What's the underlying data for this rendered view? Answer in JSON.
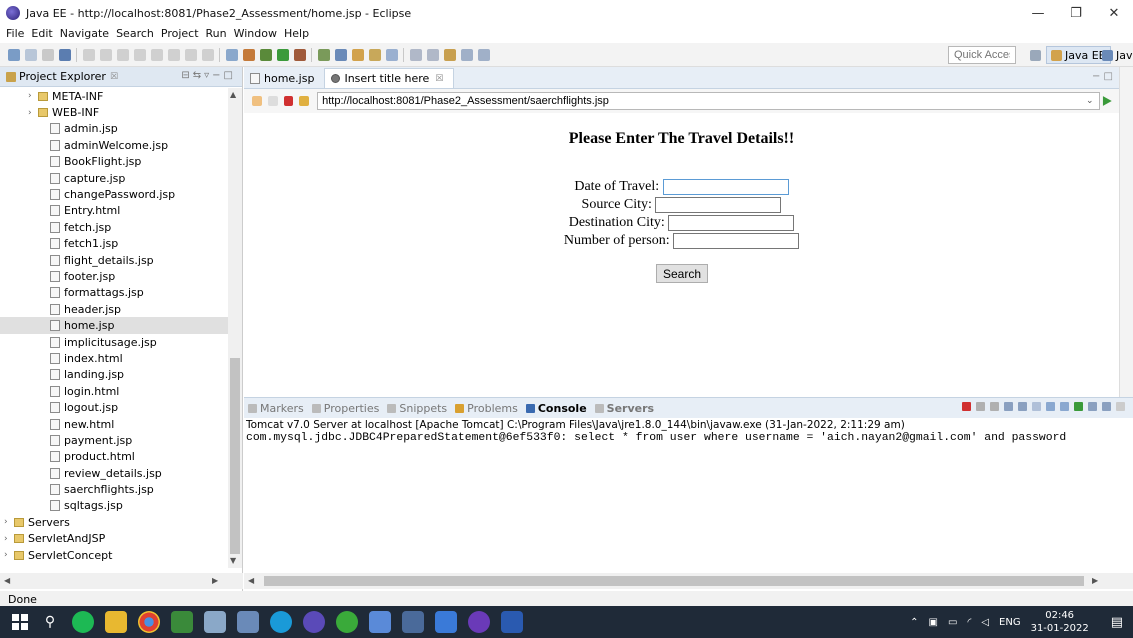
{
  "window": {
    "title": "Java EE - http://localhost:8081/Phase2_Assessment/home.jsp - Eclipse",
    "minimize": "—",
    "maximize": "❐",
    "close": "✕"
  },
  "menu": [
    "File",
    "Edit",
    "Navigate",
    "Search",
    "Project",
    "Run",
    "Window",
    "Help"
  ],
  "toolbar": {
    "quick_access_placeholder": "Quick Access",
    "perspective_active": "Java EE",
    "perspective_other": "Java"
  },
  "explorer": {
    "tab_label": "Project Explorer",
    "tab_close": "☒",
    "items": [
      {
        "label": "META-INF",
        "type": "folder",
        "indent": 2,
        "twisty": "›"
      },
      {
        "label": "WEB-INF",
        "type": "folder",
        "indent": 2,
        "twisty": "›"
      },
      {
        "label": "admin.jsp",
        "type": "file",
        "indent": 3
      },
      {
        "label": "adminWelcome.jsp",
        "type": "file",
        "indent": 3
      },
      {
        "label": "BookFlight.jsp",
        "type": "file",
        "indent": 3
      },
      {
        "label": "capture.jsp",
        "type": "file",
        "indent": 3
      },
      {
        "label": "changePassword.jsp",
        "type": "file",
        "indent": 3
      },
      {
        "label": "Entry.html",
        "type": "file",
        "indent": 3
      },
      {
        "label": "fetch.jsp",
        "type": "file",
        "indent": 3
      },
      {
        "label": "fetch1.jsp",
        "type": "file",
        "indent": 3
      },
      {
        "label": "flight_details.jsp",
        "type": "file",
        "indent": 3
      },
      {
        "label": "footer.jsp",
        "type": "file",
        "indent": 3
      },
      {
        "label": "formattags.jsp",
        "type": "file",
        "indent": 3
      },
      {
        "label": "header.jsp",
        "type": "file",
        "indent": 3
      },
      {
        "label": "home.jsp",
        "type": "file",
        "indent": 3,
        "selected": true
      },
      {
        "label": "implicitusage.jsp",
        "type": "file",
        "indent": 3
      },
      {
        "label": "index.html",
        "type": "file",
        "indent": 3
      },
      {
        "label": "landing.jsp",
        "type": "file",
        "indent": 3
      },
      {
        "label": "login.html",
        "type": "file",
        "indent": 3
      },
      {
        "label": "logout.jsp",
        "type": "file",
        "indent": 3
      },
      {
        "label": "new.html",
        "type": "file",
        "indent": 3
      },
      {
        "label": "payment.jsp",
        "type": "file",
        "indent": 3
      },
      {
        "label": "product.html",
        "type": "file",
        "indent": 3
      },
      {
        "label": "review_details.jsp",
        "type": "file",
        "indent": 3
      },
      {
        "label": "saerchflights.jsp",
        "type": "file",
        "indent": 3
      },
      {
        "label": "sqltags.jsp",
        "type": "file",
        "indent": 3
      },
      {
        "label": "Servers",
        "type": "folder",
        "indent": 0,
        "twisty": "›"
      },
      {
        "label": "ServletAndJSP",
        "type": "proj",
        "indent": 0,
        "twisty": "›"
      },
      {
        "label": "ServletConcept",
        "type": "proj",
        "indent": 0,
        "twisty": "›"
      }
    ]
  },
  "editor": {
    "tabs": [
      {
        "label": "home.jsp",
        "active": false
      },
      {
        "label": "Insert title here",
        "active": true,
        "close": "☒"
      }
    ],
    "url": "http://localhost:8081/Phase2_Assessment/saerchflights.jsp",
    "page": {
      "heading": "Please Enter The Travel Details!!",
      "fields": [
        {
          "label": "Date of Travel:",
          "value": ""
        },
        {
          "label": "Source City:",
          "value": ""
        },
        {
          "label": "Destination City:",
          "value": ""
        },
        {
          "label": "Number of person:",
          "value": ""
        }
      ],
      "search_button": "Search"
    }
  },
  "console": {
    "tabs": [
      "Markers",
      "Properties",
      "Snippets",
      "Problems",
      "Console",
      "Servers"
    ],
    "active_tab": "Console",
    "description": "Tomcat v7.0 Server at localhost [Apache Tomcat] C:\\Program Files\\Java\\jre1.8.0_144\\bin\\javaw.exe (31-Jan-2022, 2:11:29 am)",
    "output": "com.mysql.jdbc.JDBC4PreparedStatement@6ef533f0: select * from user where username = 'aich.nayan2@gmail.com' and password"
  },
  "status": "Done",
  "taskbar": {
    "language": "ENG",
    "time": "02:46",
    "date": "31-01-2022"
  }
}
